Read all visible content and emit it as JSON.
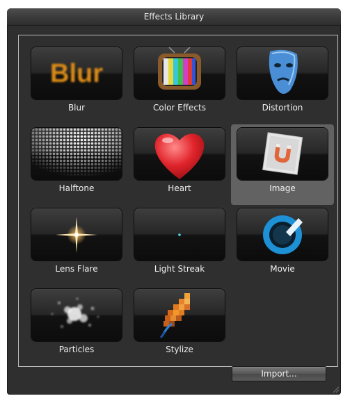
{
  "window": {
    "title": "Effects Library"
  },
  "effects": [
    {
      "label": "Blur",
      "thumb_text": "Blur",
      "selected": false
    },
    {
      "label": "Color Effects",
      "selected": false
    },
    {
      "label": "Distortion",
      "selected": false
    },
    {
      "label": "Halftone",
      "selected": false
    },
    {
      "label": "Heart",
      "selected": false
    },
    {
      "label": "Image",
      "selected": true
    },
    {
      "label": "Lens Flare",
      "selected": false
    },
    {
      "label": "Light Streak",
      "selected": false
    },
    {
      "label": "Movie",
      "selected": false
    },
    {
      "label": "Particles",
      "selected": false
    },
    {
      "label": "Stylize",
      "selected": false
    }
  ],
  "buttons": {
    "import_label": "Import..."
  },
  "colors": {
    "panel_bg": "#2f2f2f",
    "selection_bg": "#626262",
    "blur_text": "#d98a14"
  }
}
